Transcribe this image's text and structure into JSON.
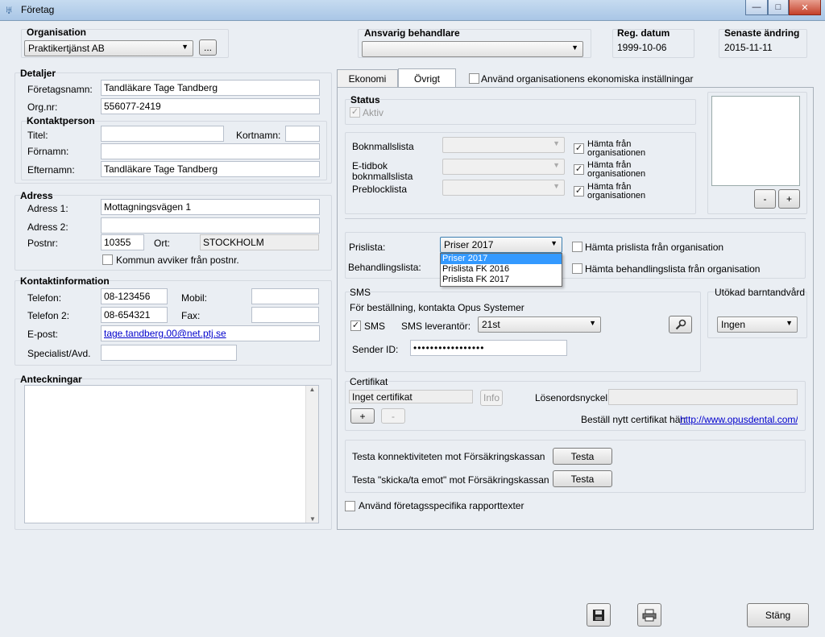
{
  "window": {
    "title": "Företag",
    "min": "—",
    "max": "□",
    "close": "✕",
    "app_icon": "tooth-icon"
  },
  "header": {
    "organisation_label": "Organisation",
    "organisation_value": "Praktikertjänst AB",
    "organisation_browse": "...",
    "ansvarig_label": "Ansvarig behandlare",
    "ansvarig_value": "",
    "reg_datum_label": "Reg. datum",
    "reg_datum_value": "1999-10-06",
    "senaste_andring_label": "Senaste ändring",
    "senaste_andring_value": "2015-11-11"
  },
  "detaljer": {
    "title": "Detaljer",
    "foretagsnamn_label": "Företagsnamn:",
    "foretagsnamn_value": "Tandläkare Tage Tandberg",
    "orgnr_label": "Org.nr:",
    "orgnr_value": "556077-2419",
    "kontaktperson_title": "Kontaktperson",
    "titel_label": "Titel:",
    "titel_value": "",
    "kortnamn_label": "Kortnamn:",
    "kortnamn_value": "",
    "fornamn_label": "Förnamn:",
    "fornamn_value": "",
    "efternamn_label": "Efternamn:",
    "efternamn_value": "Tandläkare Tage Tandberg"
  },
  "adress": {
    "title": "Adress",
    "adress1_label": "Adress 1:",
    "adress1_value": "Mottagningsvägen 1",
    "adress2_label": "Adress 2:",
    "adress2_value": "",
    "postnr_label": "Postnr:",
    "postnr_value": "10355",
    "ort_label": "Ort:",
    "ort_value": "STOCKHOLM",
    "kommun_label": "Kommun avviker från postnr.",
    "kommun_checked": false
  },
  "kontakt": {
    "title": "Kontaktinformation",
    "telefon_label": "Telefon:",
    "telefon_value": "08-123456",
    "mobil_label": "Mobil:",
    "mobil_value": "",
    "telefon2_label": "Telefon 2:",
    "telefon2_value": "08-654321",
    "fax_label": "Fax:",
    "fax_value": "",
    "epost_label": "E-post:",
    "epost_value": "tage.tandberg.00@net.ptj.se",
    "specialist_label": "Specialist/Avd.",
    "specialist_value": ""
  },
  "anteckningar": {
    "title": "Anteckningar",
    "value": ""
  },
  "tabs": {
    "ekonomi": "Ekonomi",
    "ovrigt": "Övrigt",
    "use_org_label": "Använd organisationens ekonomiska inställningar"
  },
  "status": {
    "title": "Status",
    "aktiv_label": "Aktiv",
    "aktiv_checked": true
  },
  "lists": {
    "boknmall_label": "Boknmallslista",
    "etidbok_label_1": "E-tidbok",
    "etidbok_label_2": "boknmallslista",
    "preblock_label": "Preblocklista",
    "hamta_1": "Hämta från",
    "hamta_2": "organisationen"
  },
  "image_buttons": {
    "minus": "-",
    "plus": "+"
  },
  "prislista": {
    "label": "Prislista:",
    "value": "Priser 2017",
    "hamta_label": "Hämta prislista från organisation",
    "behandling_label": "Behandlingslista:",
    "behandling_hamta_label": "Hämta behandlingslista från organisation",
    "options": [
      "Priser 2017",
      "Prislista FK 2016",
      "Prislista FK 2017"
    ]
  },
  "sms": {
    "title": "SMS",
    "info": "För beställning, kontakta Opus Systemer",
    "sms_label": "SMS",
    "sms_checked": true,
    "leverantor_label": "SMS leverantör:",
    "leverantor_value": "21st",
    "sender_label": "Sender ID:",
    "sender_value": "•••••••••••••••••",
    "tool_icon": "wrench-icon"
  },
  "barntandvard": {
    "title": "Utökad barntandvård",
    "value": "Ingen"
  },
  "certifikat": {
    "title": "Certifikat",
    "value": "Inget certifikat",
    "info_button": "Info",
    "losenord_label": "Lösenordsnyckel",
    "losenord_value": "",
    "add": "+",
    "remove": "-",
    "bestall_label": "Beställ nytt certifikat här:",
    "bestall_link": "http://www.opusdental.com/se"
  },
  "fk": {
    "test1_label": "Testa konnektiviteten mot Försäkringskassan",
    "test1_button": "Testa",
    "test2_label": "Testa \"skicka/ta emot\" mot Försäkringskassan",
    "test2_button": "Testa"
  },
  "rapport": {
    "label": "Använd företagsspecifika rapporttexter",
    "checked": false
  },
  "footer": {
    "save_icon": "floppy-disk-icon",
    "print_icon": "printer-icon",
    "close_button": "Stäng"
  }
}
